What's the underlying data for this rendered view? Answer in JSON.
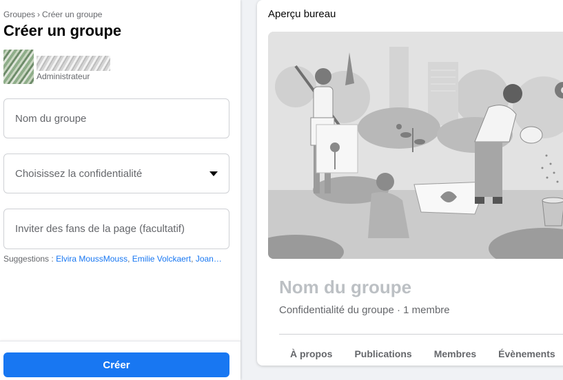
{
  "breadcrumb": {
    "parent": "Groupes",
    "separator": "›",
    "current": "Créer un groupe"
  },
  "page_title": "Créer un groupe",
  "admin": {
    "role": "Administrateur"
  },
  "form": {
    "group_name_placeholder": "Nom du groupe",
    "privacy_label": "Choisissez la confidentialité",
    "invite_placeholder": "Inviter des fans de la page (facultatif)"
  },
  "suggestions": {
    "label": "Suggestions :",
    "names": [
      "Elvira MoussMouss",
      "Emilie Volckaert",
      "Joan…"
    ]
  },
  "create_button": "Créer",
  "preview": {
    "title": "Aperçu bureau",
    "group_name": "Nom du groupe",
    "group_meta": "Confidentialité du groupe · 1 membre",
    "tabs": [
      "À propos",
      "Publications",
      "Membres",
      "Évènements"
    ]
  },
  "colors": {
    "accent": "#1877f2",
    "secondary_text": "#65676b",
    "placeholder_title": "#bcc0c4"
  }
}
